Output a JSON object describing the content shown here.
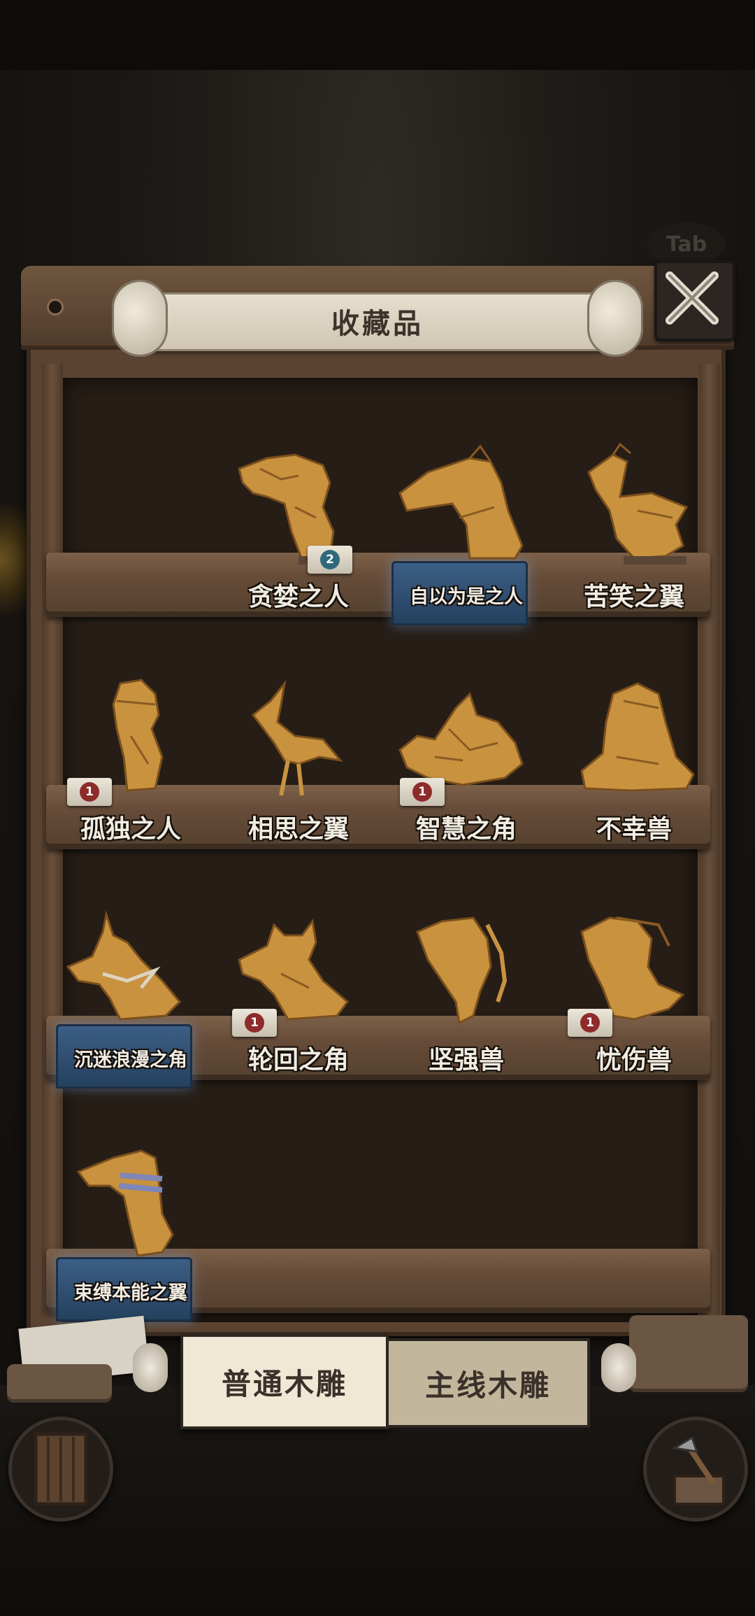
{
  "header": {
    "title": "收藏品",
    "tab_hint": "Tab"
  },
  "shelves": [
    {
      "items": [
        {
          "name": "贪婪之人",
          "badge": "2",
          "badge_color": "teal",
          "highlight": false
        },
        {
          "name": "自以为是之人",
          "badge": null,
          "highlight": true
        },
        {
          "name": "苦笑之翼",
          "badge": null,
          "highlight": false
        }
      ]
    },
    {
      "items": [
        {
          "name": "孤独之人",
          "badge": "1",
          "badge_color": "red",
          "highlight": false
        },
        {
          "name": "相思之翼",
          "badge": null,
          "highlight": false
        },
        {
          "name": "智慧之角",
          "badge": "1",
          "badge_color": "red",
          "highlight": false
        },
        {
          "name": "不幸兽",
          "badge": null,
          "highlight": false
        }
      ]
    },
    {
      "items": [
        {
          "name": "沉迷浪漫之角",
          "badge": null,
          "highlight": true
        },
        {
          "name": "轮回之角",
          "badge": "1",
          "badge_color": "red",
          "highlight": false
        },
        {
          "name": "坚强兽",
          "badge": null,
          "highlight": false
        },
        {
          "name": "忧伤兽",
          "badge": "1",
          "badge_color": "red",
          "highlight": false
        }
      ]
    },
    {
      "items": [
        {
          "name": "束缚本能之翼",
          "badge": null,
          "highlight": true
        }
      ]
    }
  ],
  "tabs": {
    "normal": "普通木雕",
    "main": "主线木雕"
  },
  "colors": {
    "wood": "#c8923f",
    "wood_dark": "#8a5a22",
    "highlight": "#3d5f86"
  },
  "icons": {
    "close": "close-x-icon",
    "door": "door-icon",
    "axe": "axe-stump-icon"
  }
}
